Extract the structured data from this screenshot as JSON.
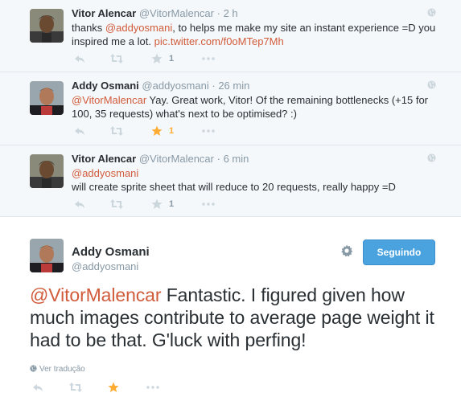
{
  "replies": [
    {
      "name": "Vitor Alencar",
      "handle": "@VitorMalencar",
      "time": "2 h",
      "text_parts": {
        "pre": "thanks ",
        "mention": "@addyosmani",
        "mid": ", to helps me make my site  an instant experience =D you inspired me a lot. ",
        "link": "pic.twitter.com/f0oMTep7Mh"
      },
      "favorites": "1",
      "favorited": false
    },
    {
      "name": "Addy Osmani",
      "handle": "@addyosmani",
      "time": "26 min",
      "text_parts": {
        "mention": "@VitorMalencar",
        "rest": " Yay. Great work, Vitor! Of the remaining bottlenecks (+15 for 100, 35 requests) what's next to be optimised? :)"
      },
      "favorites": "1",
      "favorited": true
    },
    {
      "name": "Vitor Alencar",
      "handle": "@VitorMalencar",
      "time": "6 min",
      "text_parts": {
        "mention": "@addyosmani",
        "rest": "will create sprite sheet that will reduce to 20 requests, really happy =D"
      },
      "favorites": "1",
      "favorited": false
    }
  ],
  "main_tweet": {
    "name": "Addy Osmani",
    "handle": "@addyosmani",
    "follow_label": "Seguindo",
    "mention": "@VitorMalencar",
    "rest": " Fantastic. I figured given how much images contribute to average page weight it had to be that. G'luck with perfing!",
    "translate_label": "Ver tradução",
    "favorited": true
  },
  "separator_dot": "·",
  "icons": {
    "reply": "reply-icon",
    "retweet": "retweet-icon",
    "favorite": "star-icon",
    "more": "more-icon",
    "globe": "globe-icon",
    "settings": "gear-icon"
  },
  "colors": {
    "link": "#d15c3c",
    "star_active": "#ffac33",
    "icon_muted": "#8899a6",
    "follow_button": "#4aa3df",
    "thread_bg": "#f5f8fa"
  }
}
